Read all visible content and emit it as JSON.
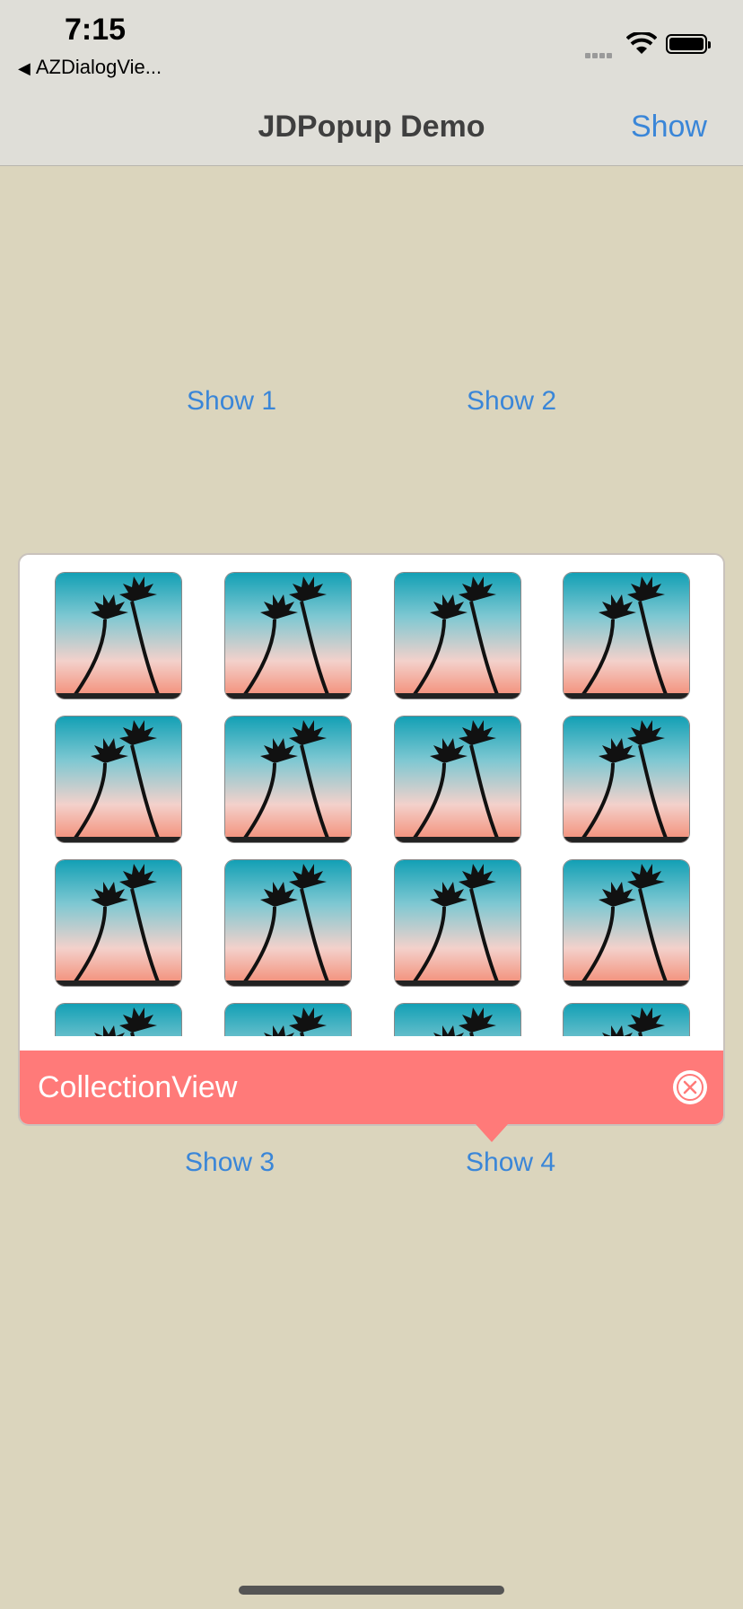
{
  "status": {
    "time": "7:15",
    "back_app": "AZDialogVie..."
  },
  "nav": {
    "title": "JDPopup Demo",
    "right_button": "Show"
  },
  "buttons": {
    "show1": "Show 1",
    "show2": "Show 2",
    "show3": "Show 3",
    "show4": "Show 4"
  },
  "popup": {
    "title": "CollectionView",
    "footer_color": "#ff7a79",
    "tile_image": "palm-trees-sunset",
    "rows_visible": 4,
    "columns": 4
  },
  "colors": {
    "background": "#dbd5bd",
    "accent": "#3a86d8"
  }
}
